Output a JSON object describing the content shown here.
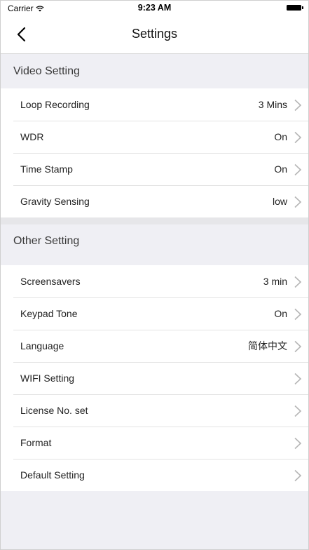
{
  "status_bar": {
    "carrier": "Carrier",
    "time": "9:23 AM"
  },
  "nav": {
    "title": "Settings"
  },
  "sections": {
    "video": {
      "header": "Video Setting",
      "items": [
        {
          "label": "Loop Recording",
          "value": "3 Mins"
        },
        {
          "label": "WDR",
          "value": "On"
        },
        {
          "label": "Time Stamp",
          "value": "On"
        },
        {
          "label": "Gravity Sensing",
          "value": "low"
        }
      ]
    },
    "other": {
      "header": "Other Setting",
      "items": [
        {
          "label": "Screensavers",
          "value": "3 min"
        },
        {
          "label": "Keypad Tone",
          "value": "On"
        },
        {
          "label": "Language",
          "value": "简体中文"
        },
        {
          "label": "WIFI Setting",
          "value": ""
        },
        {
          "label": "License No. set",
          "value": ""
        },
        {
          "label": "Format",
          "value": ""
        },
        {
          "label": "Default Setting",
          "value": ""
        }
      ]
    }
  },
  "colors": {
    "background": "#efeff4",
    "chevron": "#b5b5b5"
  }
}
